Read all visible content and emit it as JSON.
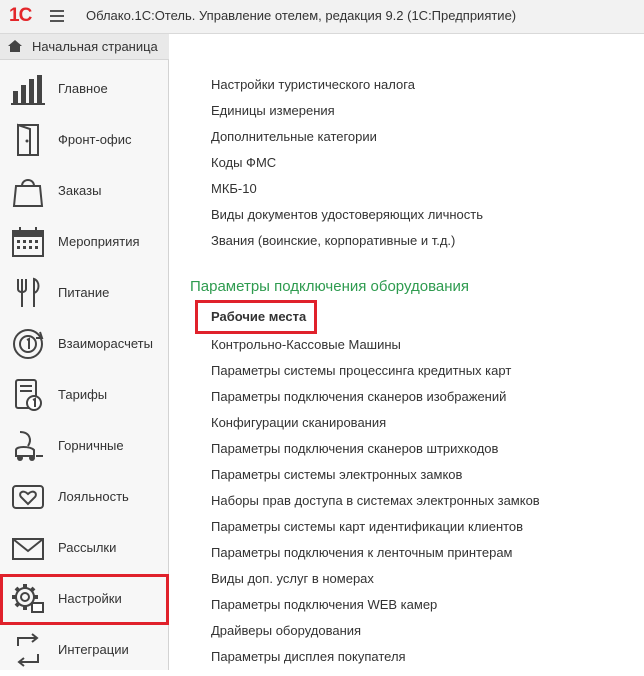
{
  "titlebar": {
    "logo": "1С",
    "title": "Облако.1С:Отель. Управление отелем, редакция 9.2  (1С:Предприятие)"
  },
  "sidebar": {
    "home_label": "Начальная страница",
    "items": [
      {
        "label": "Главное",
        "icon": "bar-chart-icon"
      },
      {
        "label": "Фронт-офис",
        "icon": "door-icon"
      },
      {
        "label": "Заказы",
        "icon": "shopping-bag-icon"
      },
      {
        "label": "Мероприятия",
        "icon": "calendar-icon"
      },
      {
        "label": "Питание",
        "icon": "cutlery-icon"
      },
      {
        "label": "Взаиморасчеты",
        "icon": "refresh-coin-icon"
      },
      {
        "label": "Тарифы",
        "icon": "price-list-icon"
      },
      {
        "label": "Горничные",
        "icon": "vacuum-icon"
      },
      {
        "label": "Лояльность",
        "icon": "heart-card-icon"
      },
      {
        "label": "Рассылки",
        "icon": "envelope-icon"
      },
      {
        "label": "Настройки",
        "icon": "gear-icon"
      },
      {
        "label": "Интеграции",
        "icon": "arrows-icon"
      }
    ],
    "highlight_color": "#e0212b"
  },
  "main": {
    "links_top": [
      "Настройки туристического налога",
      "Единицы измерения",
      "Дополнительные категории",
      "Коды ФМС",
      "МКБ-10",
      "Виды документов удостоверяющих личность",
      "Звания (воинские, корпоративные и т.д.)"
    ],
    "section_title": "Параметры подключения оборудования",
    "section_color": "#2e9b4f",
    "selected_link": "Рабочие места",
    "links_equipment": [
      "Контрольно-Кассовые Машины",
      "Параметры системы процессинга кредитных карт",
      "Параметры подключения сканеров изображений",
      "Конфигурации сканирования",
      "Параметры подключения сканеров штрихкодов",
      "Параметры системы электронных замков",
      "Наборы прав доступа в системах электронных замков",
      "Параметры системы карт идентификации клиентов",
      "Параметры подключения к ленточным принтерам",
      "Виды доп. услуг в номерах",
      "Параметры подключения WEB камер",
      "Драйверы оборудования",
      "Параметры дисплея покупателя"
    ]
  }
}
